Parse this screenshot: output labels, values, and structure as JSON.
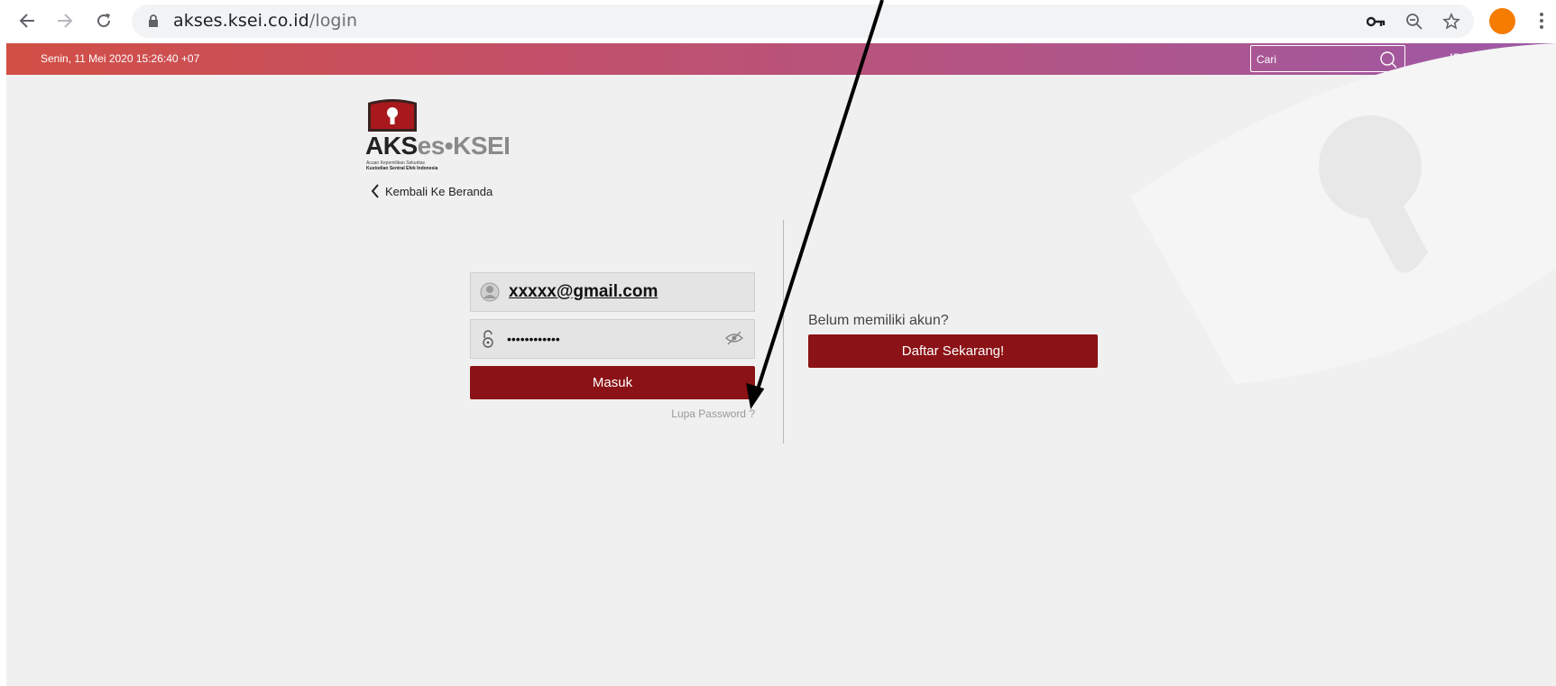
{
  "browser": {
    "url_host": "akses.ksei.co.id",
    "url_path": "/login",
    "back_icon": "arrow-left-icon",
    "forward_icon": "arrow-right-icon",
    "reload_icon": "reload-icon",
    "lock_icon": "lock-icon",
    "key_icon": "key-icon",
    "zoom_icon": "zoom-out-icon",
    "star_icon": "star-icon",
    "menu_icon": "kebab-menu-icon",
    "profile_color": "#f57c00"
  },
  "topbar": {
    "datetime": "Senin, 11 Mei 2020 15:26:40 +07",
    "search_placeholder": "Cari",
    "language": "ID",
    "language_caret": "▼",
    "gradient_start": "#d24f45",
    "gradient_end": "#9d59a6"
  },
  "logo": {
    "main_aks": "AKS",
    "main_es": "es",
    "main_dot": "•",
    "main_ksei": "KSEI",
    "sub1": "Acuan Kepemilikan Sekuritas",
    "sub2": "Kustodian Sentral Efek Indonesia"
  },
  "nav": {
    "back_label": "Kembali Ke Beranda"
  },
  "login": {
    "email_value": "xxxxx@gmail.com",
    "password_value": "••••••••••••",
    "submit_label": "Masuk",
    "forgot_label": "Lupa Password ?"
  },
  "register": {
    "question": "Belum memiliki akun?",
    "button_label": "Daftar Sekarang!"
  },
  "colors": {
    "button": "#8b1216",
    "page_bg": "#f1f0f0"
  }
}
